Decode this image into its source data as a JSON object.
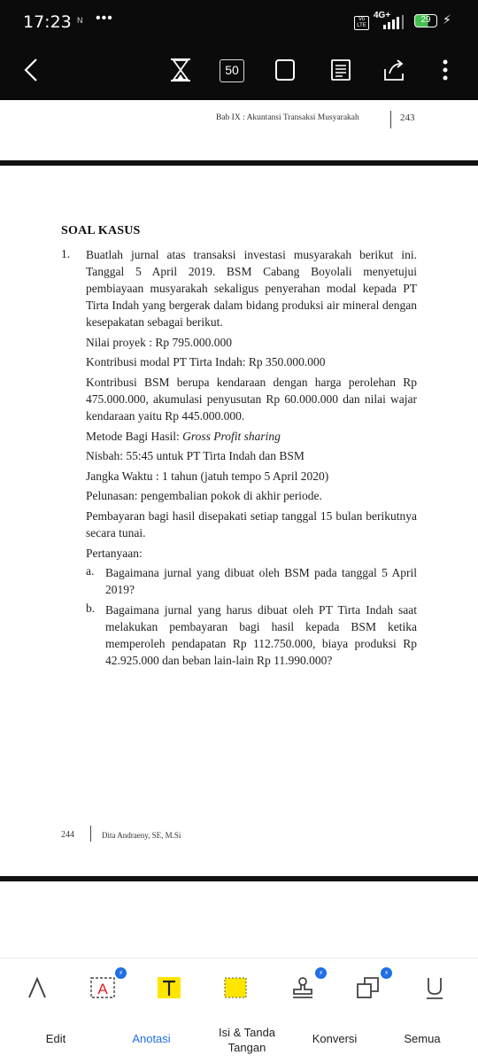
{
  "status_bar": {
    "time": "17:23",
    "notif_icon": "N",
    "more": "•••",
    "volte": "Vo LTE",
    "network": "4G+",
    "battery": "29"
  },
  "toolbar": {
    "page_number": "50",
    "icons": [
      "back-arrow-icon",
      "hourglass-icon",
      "page-number-icon",
      "fullscreen-icon",
      "reading-mode-icon",
      "share-icon",
      "more-vert-icon"
    ]
  },
  "document": {
    "prev_page": {
      "running_head": "Bab IX : Akuntansi Transaksi Musyarakah",
      "page_number": "243"
    },
    "case_title": "SOAL KASUS",
    "item_number": "1.",
    "intro": "Buatlah jurnal atas transaksi investasi musyarakah berikut ini. Tanggal 5 April 2019. BSM Cabang Boyolali menyetujui pembiayaan musyarakah sekaligus penyerahan modal kepada PT Tirta Indah yang bergerak dalam bidang produksi air mineral dengan kesepakatan sebagai berikut.",
    "nilai_proyek": "Nilai proyek : Rp 795.000.000",
    "kontribusi_modal": "Kontribusi modal PT Tirta Indah: Rp 350.000.000",
    "kontribusi_bsm": "Kontribusi BSM berupa kendaraan dengan harga perolehan Rp 475.000.000, akumulasi penyusutan Rp 60.000.000 dan nilai wajar kendaraan yaitu Rp 445.000.000.",
    "metode_label": "Metode Bagi Hasil: ",
    "metode_value": "Gross Profit sharing",
    "nisbah": "Nisbah: 55:45 untuk PT Tirta Indah dan BSM",
    "jangka_waktu": "Jangka Waktu : 1 tahun (jatuh tempo 5 April 2020)",
    "pelunasan": "Pelunasan: pengembalian pokok di akhir periode.",
    "pembayaran": "Pembayaran bagi hasil disepakati setiap tanggal 15 bulan berikutnya secara tunai.",
    "pertanyaan": "Pertanyaan:",
    "questions": [
      {
        "letter": "a.",
        "text": "Bagaimana jurnal yang dibuat oleh BSM pada tanggal 5 April 2019?"
      },
      {
        "letter": "b.",
        "text": "Bagaimana jurnal yang harus dibuat oleh PT Tirta Indah saat melakukan pembayaran bagi hasil kepada BSM ketika memperoleh pendapatan Rp 112.750.000, biaya produksi Rp 42.925.000 dan beban lain-lain Rp 11.990.000?"
      }
    ],
    "footer": {
      "page_number": "244",
      "author": "Dita Andraeny, SE, M.Si"
    }
  },
  "bottom_bar": {
    "tools": [
      "pen-icon",
      "text-box-icon",
      "text-highlight-icon",
      "area-highlight-icon",
      "stamp-icon",
      "shape-icon",
      "underline-icon"
    ],
    "tabs": [
      {
        "label": "Edit",
        "active": false
      },
      {
        "label": "Anotasi",
        "active": true
      },
      {
        "label": "Isi & Tanda Tangan",
        "active": false
      },
      {
        "label": "Konversi",
        "active": false
      },
      {
        "label": "Semua",
        "active": false
      }
    ],
    "accent": "#1f6fe6",
    "highlight_yellow": "#ffe600"
  }
}
